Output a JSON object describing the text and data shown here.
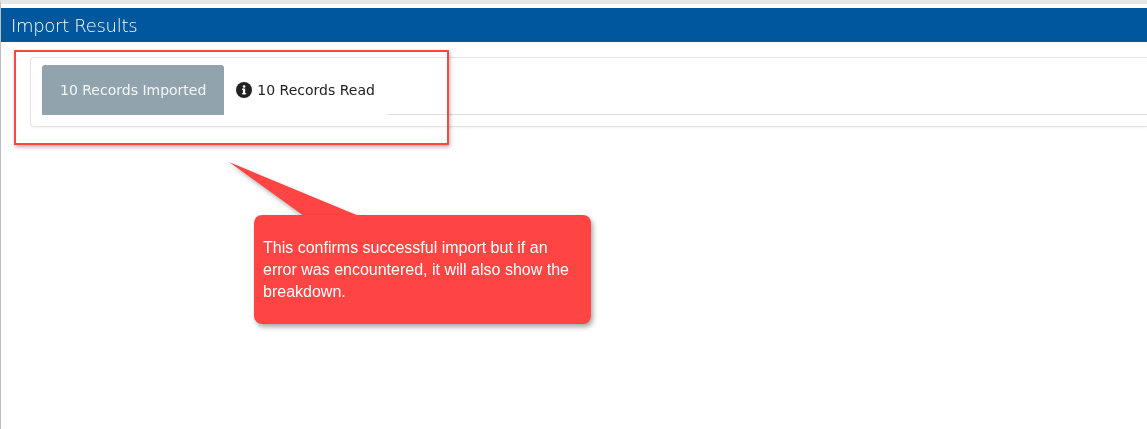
{
  "window": {
    "title": "Import Results"
  },
  "tabs": [
    {
      "label": "10 Records Imported",
      "selected": true,
      "kind": "plain"
    },
    {
      "label": "10 Records Read",
      "selected": false,
      "kind": "info"
    }
  ],
  "callout": {
    "text": "This confirms successful import but if an error was encountered, it will also show the breakdown."
  }
}
